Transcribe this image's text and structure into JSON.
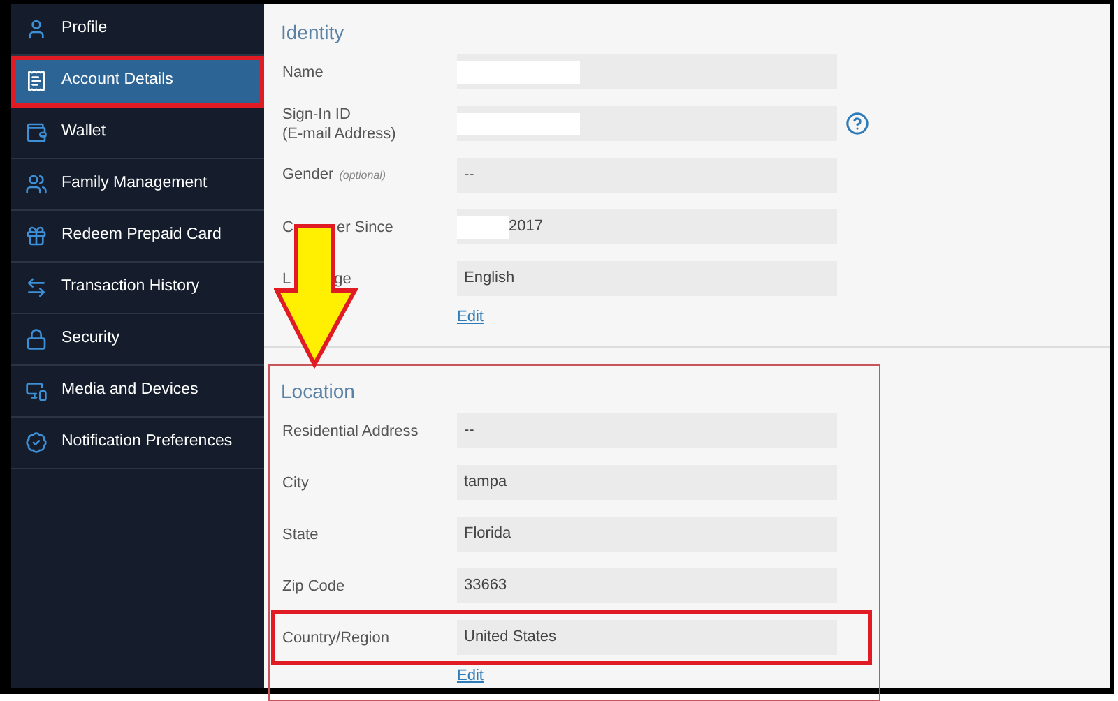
{
  "sidebar": {
    "items": [
      {
        "label": "Profile",
        "selected": false,
        "highlighted": false
      },
      {
        "label": "Account Details",
        "selected": true,
        "highlighted": true
      },
      {
        "label": "Wallet",
        "selected": false,
        "highlighted": false
      },
      {
        "label": "Family Management",
        "selected": false,
        "highlighted": false
      },
      {
        "label": "Redeem Prepaid Card",
        "selected": false,
        "highlighted": false
      },
      {
        "label": "Transaction History",
        "selected": false,
        "highlighted": false
      },
      {
        "label": "Security",
        "selected": false,
        "highlighted": false
      },
      {
        "label": "Media and Devices",
        "selected": false,
        "highlighted": false
      },
      {
        "label": "Notification Preferences",
        "selected": false,
        "highlighted": false
      }
    ]
  },
  "sections": [
    {
      "title": "Identity",
      "highlighted": false,
      "edit": "Edit",
      "rows": [
        {
          "label": "Name",
          "redacted": true,
          "highlighted": false
        },
        {
          "label": "Sign-In ID",
          "sublabel": "(E-mail Address)",
          "redacted": true,
          "help": true,
          "highlighted": false
        },
        {
          "label": "Gender",
          "note": "(optional)",
          "value": "--",
          "highlighted": false
        },
        {
          "label": "C",
          "label_tail": "er Since",
          "value": "2017",
          "redacted": true,
          "highlighted": false
        },
        {
          "label": "L",
          "label_tail": "ge",
          "value": "English",
          "highlighted": false
        }
      ]
    },
    {
      "title": "Location",
      "highlighted": true,
      "edit": "Edit",
      "rows": [
        {
          "label": "Residential Address",
          "value": "--",
          "highlighted": false
        },
        {
          "label": "City",
          "value": "tampa",
          "highlighted": false
        },
        {
          "label": "State",
          "value": "Florida",
          "highlighted": false
        },
        {
          "label": "Zip Code",
          "value": "33663",
          "highlighted": false
        },
        {
          "label": "Country/Region",
          "value": "United States",
          "highlighted": true
        }
      ]
    }
  ]
}
